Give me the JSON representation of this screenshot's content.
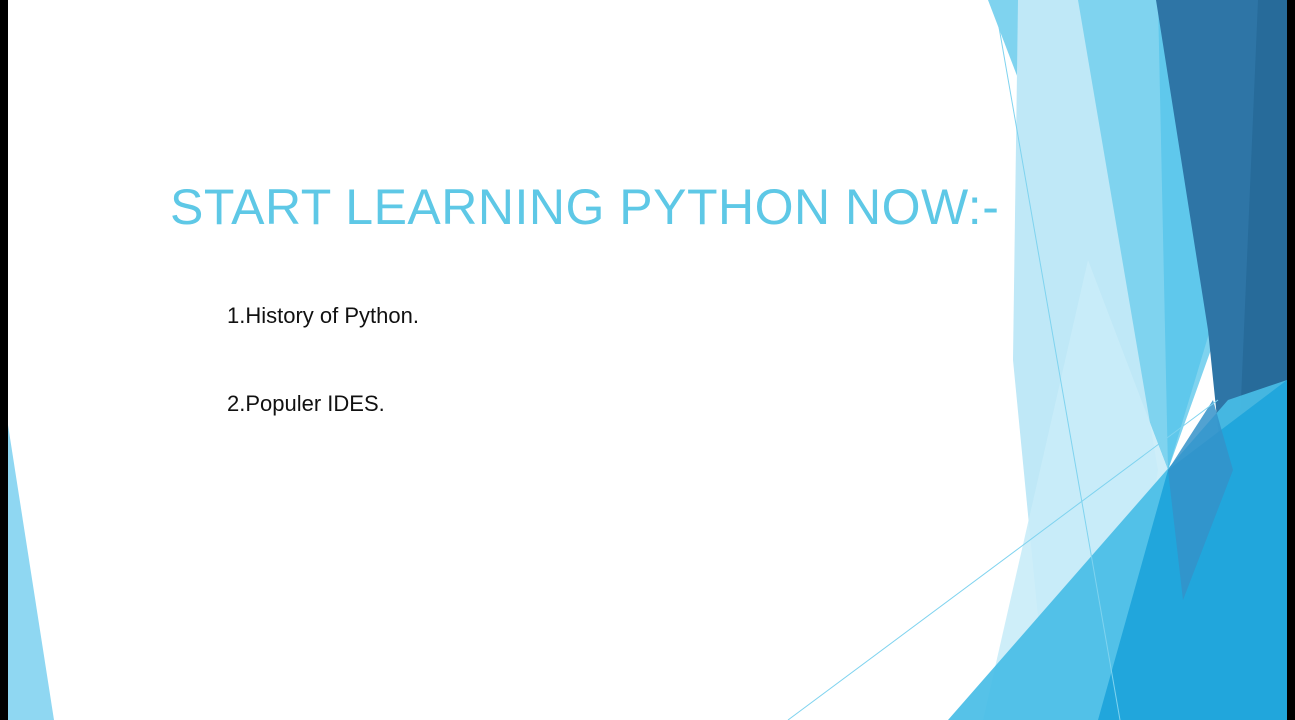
{
  "slide": {
    "title": "START LEARNING PYTHON NOW:-",
    "bullets": [
      {
        "text": "1.History of Python."
      },
      {
        "text": "2.Populer IDES."
      }
    ]
  },
  "theme": {
    "title_color": "#5ec8e6",
    "body_color": "#111111",
    "background_color": "#ffffff",
    "frame_color": "#000000",
    "accent_colors": [
      "#7fd3ef",
      "#2e75a6",
      "#5fc8ec",
      "#21a6dc",
      "#bfe8f7"
    ]
  }
}
